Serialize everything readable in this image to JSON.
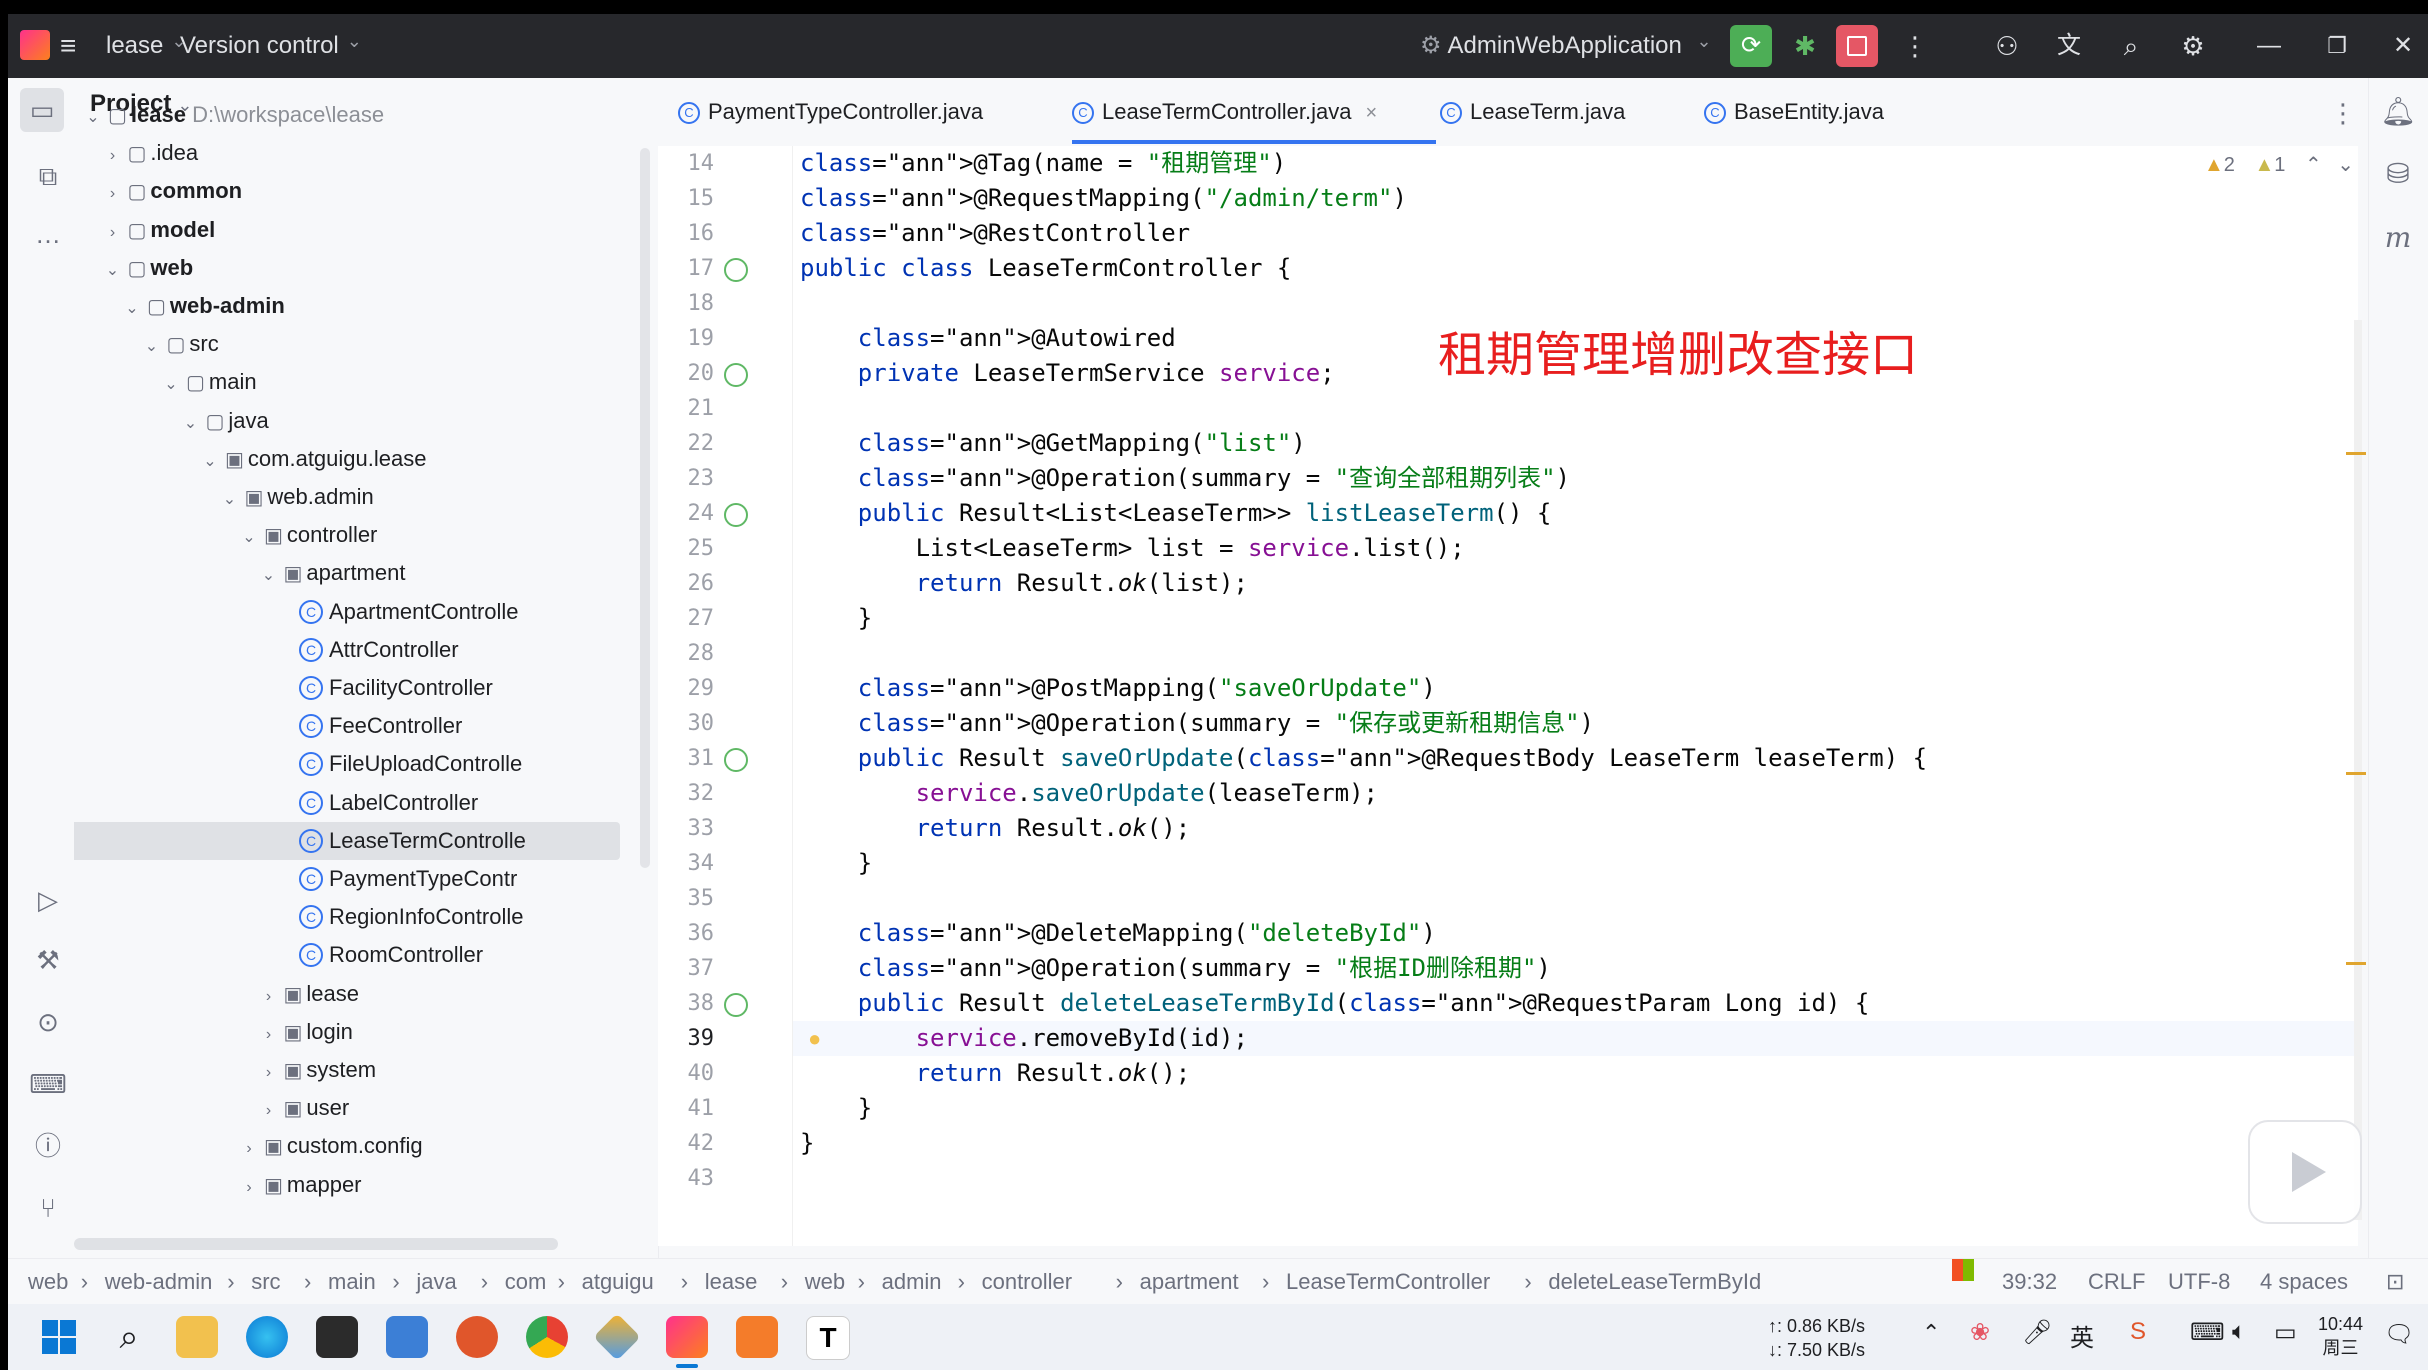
{
  "titlebar": {
    "project_name": "lease",
    "vcs": "Version control",
    "run_config": "AdminWebApplication"
  },
  "sidebar_panel": {
    "title": "Project",
    "root_name": "lease",
    "root_path": "D:\\workspace\\lease",
    "items": [
      {
        "label": "lease",
        "indent": 0,
        "type": "root"
      },
      {
        "label": ".idea",
        "indent": 1,
        "type": "folder"
      },
      {
        "label": "common",
        "indent": 1,
        "type": "module"
      },
      {
        "label": "model",
        "indent": 1,
        "type": "module"
      },
      {
        "label": "web",
        "indent": 1,
        "type": "module"
      },
      {
        "label": "web-admin",
        "indent": 2,
        "type": "module"
      },
      {
        "label": "src",
        "indent": 3,
        "type": "folder"
      },
      {
        "label": "main",
        "indent": 4,
        "type": "folder"
      },
      {
        "label": "java",
        "indent": 5,
        "type": "folder"
      },
      {
        "label": "com.atguigu.lease",
        "indent": 6,
        "type": "package"
      },
      {
        "label": "web.admin",
        "indent": 7,
        "type": "package"
      },
      {
        "label": "controller",
        "indent": 8,
        "type": "package"
      },
      {
        "label": "apartment",
        "indent": 9,
        "type": "package"
      },
      {
        "label": "ApartmentControlle",
        "indent": 10,
        "type": "class"
      },
      {
        "label": "AttrController",
        "indent": 10,
        "type": "class"
      },
      {
        "label": "FacilityController",
        "indent": 10,
        "type": "class"
      },
      {
        "label": "FeeController",
        "indent": 10,
        "type": "class"
      },
      {
        "label": "FileUploadControlle",
        "indent": 10,
        "type": "class"
      },
      {
        "label": "LabelController",
        "indent": 10,
        "type": "class"
      },
      {
        "label": "LeaseTermControlle",
        "indent": 10,
        "type": "class",
        "selected": true
      },
      {
        "label": "PaymentTypeContr",
        "indent": 10,
        "type": "class"
      },
      {
        "label": "RegionInfoControlle",
        "indent": 10,
        "type": "class"
      },
      {
        "label": "RoomController",
        "indent": 10,
        "type": "class"
      },
      {
        "label": "lease",
        "indent": 9,
        "type": "package"
      },
      {
        "label": "login",
        "indent": 9,
        "type": "package"
      },
      {
        "label": "system",
        "indent": 9,
        "type": "package"
      },
      {
        "label": "user",
        "indent": 9,
        "type": "package"
      },
      {
        "label": "custom.config",
        "indent": 8,
        "type": "package"
      },
      {
        "label": "mapper",
        "indent": 8,
        "type": "package"
      }
    ]
  },
  "tabs": [
    {
      "label": "PaymentTypeController.java"
    },
    {
      "label": "LeaseTermController.java",
      "active": true
    },
    {
      "label": "LeaseTerm.java"
    },
    {
      "label": "BaseEntity.java"
    }
  ],
  "inspections": {
    "warnings": "2",
    "weak_warnings": "1"
  },
  "overlay_caption": "租期管理增删改查接口",
  "editor": {
    "current_line": "39",
    "lines": [
      {
        "n": "14",
        "code": "@Tag(name = \"租期管理\")"
      },
      {
        "n": "15",
        "code": "@RequestMapping(\"/admin/term\")"
      },
      {
        "n": "16",
        "code": "@RestController"
      },
      {
        "n": "17",
        "code": "public class LeaseTermController {"
      },
      {
        "n": "18",
        "code": ""
      },
      {
        "n": "19",
        "code": "    @Autowired"
      },
      {
        "n": "20",
        "code": "    private LeaseTermService service;"
      },
      {
        "n": "21",
        "code": ""
      },
      {
        "n": "22",
        "code": "    @GetMapping(\"list\")"
      },
      {
        "n": "23",
        "code": "    @Operation(summary = \"查询全部租期列表\")"
      },
      {
        "n": "24",
        "code": "    public Result<List<LeaseTerm>> listLeaseTerm() {"
      },
      {
        "n": "25",
        "code": "        List<LeaseTerm> list = service.list();"
      },
      {
        "n": "26",
        "code": "        return Result.ok(list);"
      },
      {
        "n": "27",
        "code": "    }"
      },
      {
        "n": "28",
        "code": ""
      },
      {
        "n": "29",
        "code": "    @PostMapping(\"saveOrUpdate\")"
      },
      {
        "n": "30",
        "code": "    @Operation(summary = \"保存或更新租期信息\")"
      },
      {
        "n": "31",
        "code": "    public Result saveOrUpdate(@RequestBody LeaseTerm leaseTerm) {"
      },
      {
        "n": "32",
        "code": "        service.saveOrUpdate(leaseTerm);"
      },
      {
        "n": "33",
        "code": "        return Result.ok();"
      },
      {
        "n": "34",
        "code": "    }"
      },
      {
        "n": "35",
        "code": ""
      },
      {
        "n": "36",
        "code": "    @DeleteMapping(\"deleteById\")"
      },
      {
        "n": "37",
        "code": "    @Operation(summary = \"根据ID删除租期\")"
      },
      {
        "n": "38",
        "code": "    public Result deleteLeaseTermById(@RequestParam Long id) {"
      },
      {
        "n": "39",
        "code": "        service.removeById(id);"
      },
      {
        "n": "40",
        "code": "        return Result.ok();"
      },
      {
        "n": "41",
        "code": "    }"
      },
      {
        "n": "42",
        "code": "}"
      },
      {
        "n": "43",
        "code": ""
      }
    ]
  },
  "breadcrumb": [
    "web",
    "web-admin",
    "src",
    "main",
    "java",
    "com",
    "atguigu",
    "lease",
    "web",
    "admin",
    "controller",
    "apartment",
    "LeaseTermController",
    "deleteLeaseTermById"
  ],
  "status": {
    "position": "39:32",
    "line_sep": "CRLF",
    "encoding": "UTF-8",
    "indent": "4 spaces"
  },
  "taskbar": {
    "net_up": "↑: 0.86 KB/s",
    "net_down": "↓: 7.50 KB/s",
    "time": "10:44",
    "day": "周三"
  },
  "colors": {
    "accent": "#3574f0",
    "run_green": "#4dae56",
    "stop_red": "#e55765",
    "caption_red": "#e81e1e"
  }
}
